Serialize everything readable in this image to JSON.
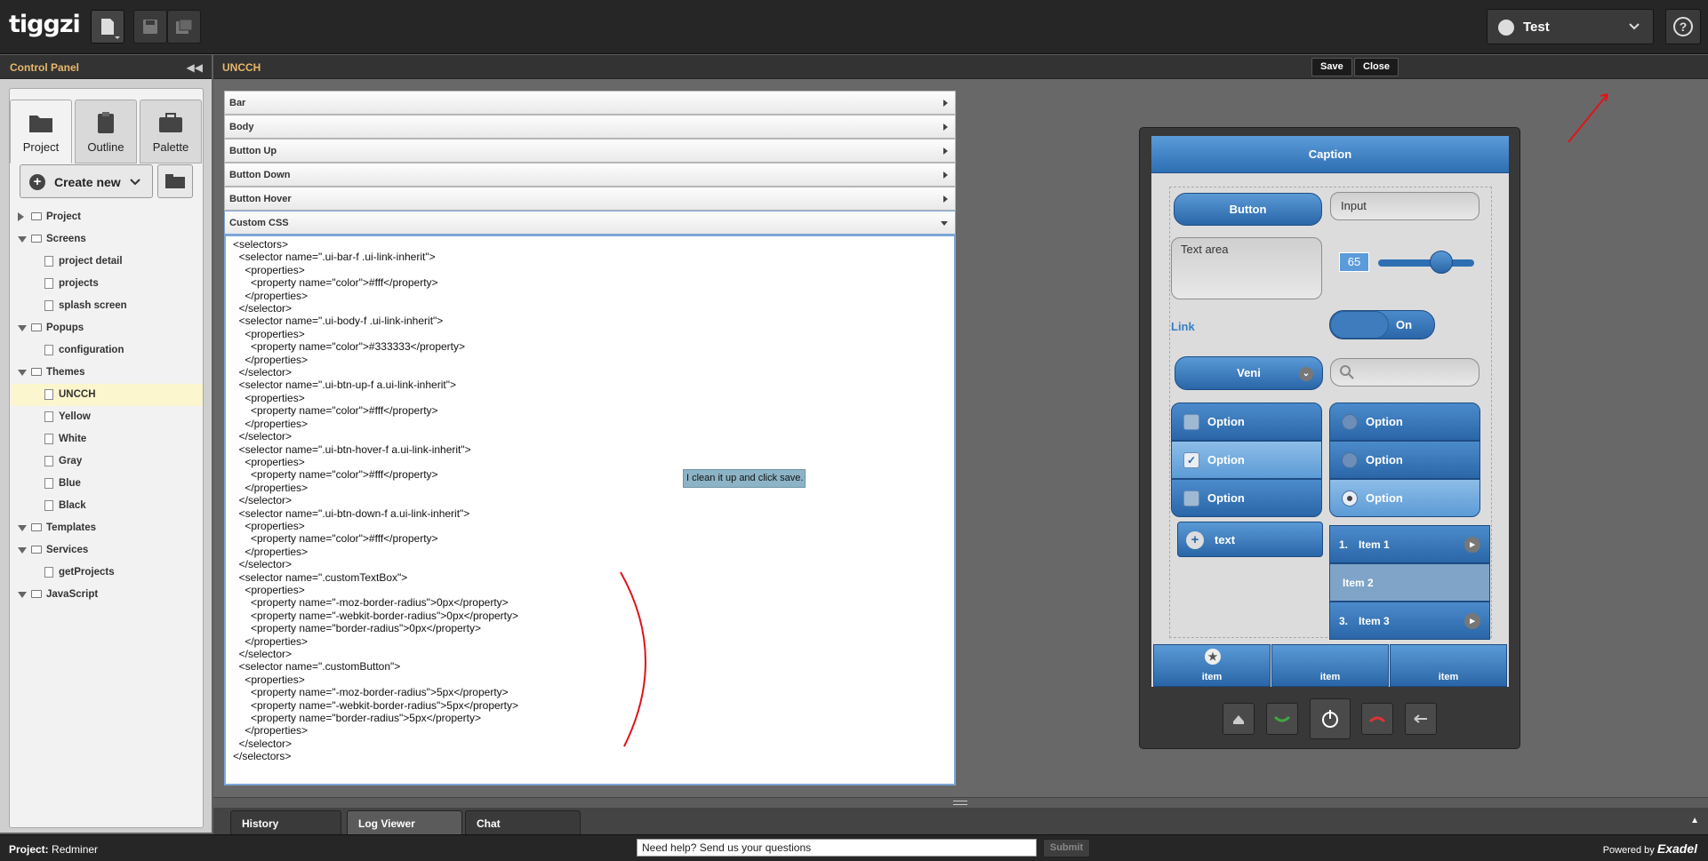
{
  "topbar": {
    "logo": "tiggzi",
    "test_label": "Test"
  },
  "control_panel": {
    "title": "Control Panel",
    "tabs": [
      {
        "label": "Project",
        "icon": "folder-icon"
      },
      {
        "label": "Outline",
        "icon": "clipboard-icon"
      },
      {
        "label": "Palette",
        "icon": "briefcase-icon"
      }
    ],
    "create_new": "Create new",
    "tree": [
      {
        "label": "Project",
        "level": 0,
        "type": "folder",
        "expanded": false
      },
      {
        "label": "Screens",
        "level": 0,
        "type": "folder",
        "expanded": true
      },
      {
        "label": "project detail",
        "level": 1,
        "type": "file"
      },
      {
        "label": "projects",
        "level": 1,
        "type": "file"
      },
      {
        "label": "splash screen",
        "level": 1,
        "type": "file"
      },
      {
        "label": "Popups",
        "level": 0,
        "type": "folder",
        "expanded": true
      },
      {
        "label": "configuration",
        "level": 1,
        "type": "file"
      },
      {
        "label": "Themes",
        "level": 0,
        "type": "folder",
        "expanded": true
      },
      {
        "label": "UNCCH",
        "level": 1,
        "type": "file",
        "selected": true
      },
      {
        "label": "Yellow",
        "level": 1,
        "type": "file"
      },
      {
        "label": "White",
        "level": 1,
        "type": "file"
      },
      {
        "label": "Gray",
        "level": 1,
        "type": "file"
      },
      {
        "label": "Blue",
        "level": 1,
        "type": "file"
      },
      {
        "label": "Black",
        "level": 1,
        "type": "file"
      },
      {
        "label": "Templates",
        "level": 0,
        "type": "folder",
        "expanded": true
      },
      {
        "label": "Services",
        "level": 0,
        "type": "folder",
        "expanded": true
      },
      {
        "label": "getProjects",
        "level": 1,
        "type": "file"
      },
      {
        "label": "JavaScript",
        "level": 0,
        "type": "folder",
        "expanded": true
      }
    ]
  },
  "editor": {
    "title": "UNCCH",
    "save_label": "Save",
    "close_label": "Close",
    "accordion": [
      "Bar",
      "Body",
      "Button Up",
      "Button Down",
      "Button Hover",
      "Custom CSS"
    ],
    "code_lines": [
      "<selectors>",
      "  <selector name=\".ui-bar-f .ui-link-inherit\">",
      "    <properties>",
      "      <property name=\"color\">#fff</property>",
      "    </properties>",
      "  </selector>",
      "  <selector name=\".ui-body-f .ui-link-inherit\">",
      "    <properties>",
      "      <property name=\"color\">#333333</property>",
      "    </properties>",
      "  </selector>",
      "  <selector name=\".ui-btn-up-f a.ui-link-inherit\">",
      "    <properties>",
      "      <property name=\"color\">#fff</property>",
      "    </properties>",
      "  </selector>",
      "  <selector name=\".ui-btn-hover-f a.ui-link-inherit\">",
      "    <properties>",
      "      <property name=\"color\">#fff</property>",
      "    </properties>",
      "  </selector>",
      "  <selector name=\".ui-btn-down-f a.ui-link-inherit\">",
      "    <properties>",
      "      <property name=\"color\">#fff</property>",
      "    </properties>",
      "  </selector>",
      "  <selector name=\".customTextBox\">",
      "    <properties>",
      "      <property name=\"-moz-border-radius\">0px</property>",
      "      <property name=\"-webkit-border-radius\">0px</property>",
      "      <property name=\"border-radius\">0px</property>",
      "    </properties>",
      "  </selector>",
      "  <selector name=\".customButton\">",
      "    <properties>",
      "      <property name=\"-moz-border-radius\">5px</property>",
      "      <property name=\"-webkit-border-radius\">5px</property>",
      "      <property name=\"border-radius\">5px</property>",
      "    </properties>",
      "  </selector>",
      "</selectors>"
    ],
    "note": "I clean it up and click save."
  },
  "preview": {
    "caption": "Caption",
    "button": "Button",
    "input": "Input",
    "textarea": "Text area",
    "slider_value": "65",
    "link": "Link",
    "toggle": "On",
    "select": "Veni",
    "options": [
      "Option",
      "Option",
      "Option",
      "Option",
      "Option",
      "Option"
    ],
    "text_button": "text",
    "list_items": [
      {
        "num": "1.",
        "label": "Item 1"
      },
      {
        "num": "",
        "label": "Item 2"
      },
      {
        "num": "3.",
        "label": "Item 3"
      }
    ],
    "nav_items": [
      "item",
      "item",
      "item"
    ]
  },
  "bottom": {
    "tabs": [
      "History",
      "Log Viewer",
      "Chat"
    ],
    "project_label": "Project:",
    "project_name": "Redminer",
    "help_placeholder": "Need help? Send us your questions",
    "submit": "Submit",
    "powered_by": "Powered by",
    "brand": "Exadel"
  },
  "colors": {
    "accent_blue": "#2e6fb3",
    "header_orange": "#e8b86a",
    "annotation_red": "#e0141a"
  }
}
